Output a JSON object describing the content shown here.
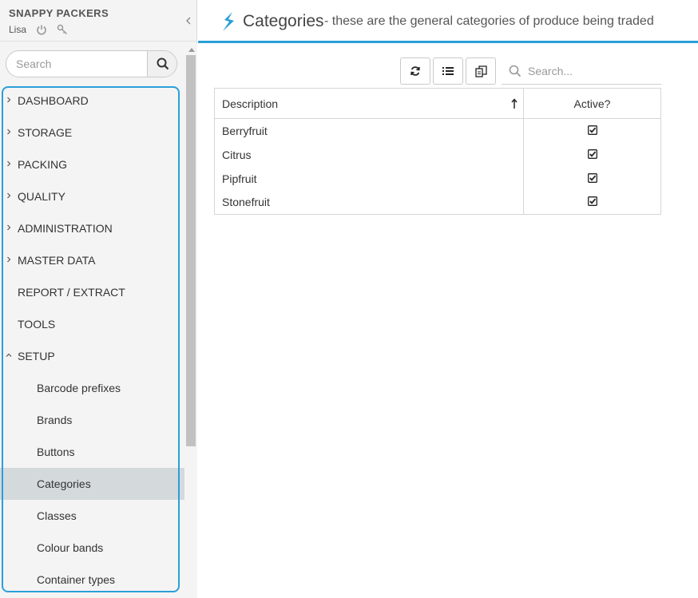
{
  "app": {
    "brand": "SNAPPY PACKERS",
    "user": "Lisa"
  },
  "icons": {
    "power": "power-icon",
    "key": "key-icon",
    "collapse": "chevron-left-icon",
    "search": "search-icon",
    "refresh": "refresh-icon",
    "list": "list-icon",
    "copy": "copy-icon",
    "sort": "sort-ascending-icon",
    "checkbox": "checkbox-checked-icon",
    "logo": "snappy-logo-icon"
  },
  "sidebar": {
    "search_placeholder": "Search",
    "items": [
      {
        "label": "DASHBOARD",
        "expandable": true,
        "expanded": false
      },
      {
        "label": "STORAGE",
        "expandable": true,
        "expanded": false
      },
      {
        "label": "PACKING",
        "expandable": true,
        "expanded": false
      },
      {
        "label": "QUALITY",
        "expandable": true,
        "expanded": false
      },
      {
        "label": "ADMINISTRATION",
        "expandable": true,
        "expanded": false
      },
      {
        "label": "MASTER DATA",
        "expandable": true,
        "expanded": false
      },
      {
        "label": "REPORT / EXTRACT",
        "expandable": false
      },
      {
        "label": "TOOLS",
        "expandable": false
      },
      {
        "label": "SETUP",
        "expandable": true,
        "expanded": true
      }
    ],
    "setup_items": [
      {
        "label": "Barcode prefixes"
      },
      {
        "label": "Brands"
      },
      {
        "label": "Buttons"
      },
      {
        "label": "Categories",
        "active": true
      },
      {
        "label": "Classes"
      },
      {
        "label": "Colour bands"
      },
      {
        "label": "Container types"
      }
    ]
  },
  "page": {
    "title": "Categories",
    "subtitle": "- these are the general categories of produce being traded"
  },
  "grid": {
    "search_placeholder": "Search...",
    "columns": [
      "Description",
      "Active?"
    ],
    "rows": [
      {
        "description": "Berryfruit",
        "active": true
      },
      {
        "description": "Citrus",
        "active": true
      },
      {
        "description": "Pipfruit",
        "active": true
      },
      {
        "description": "Stonefruit",
        "active": true
      }
    ]
  },
  "colors": {
    "accent": "#2a9fd8",
    "active_item_bg": "#d4d9dc",
    "sidebar_bg": "#f4f4f4"
  }
}
